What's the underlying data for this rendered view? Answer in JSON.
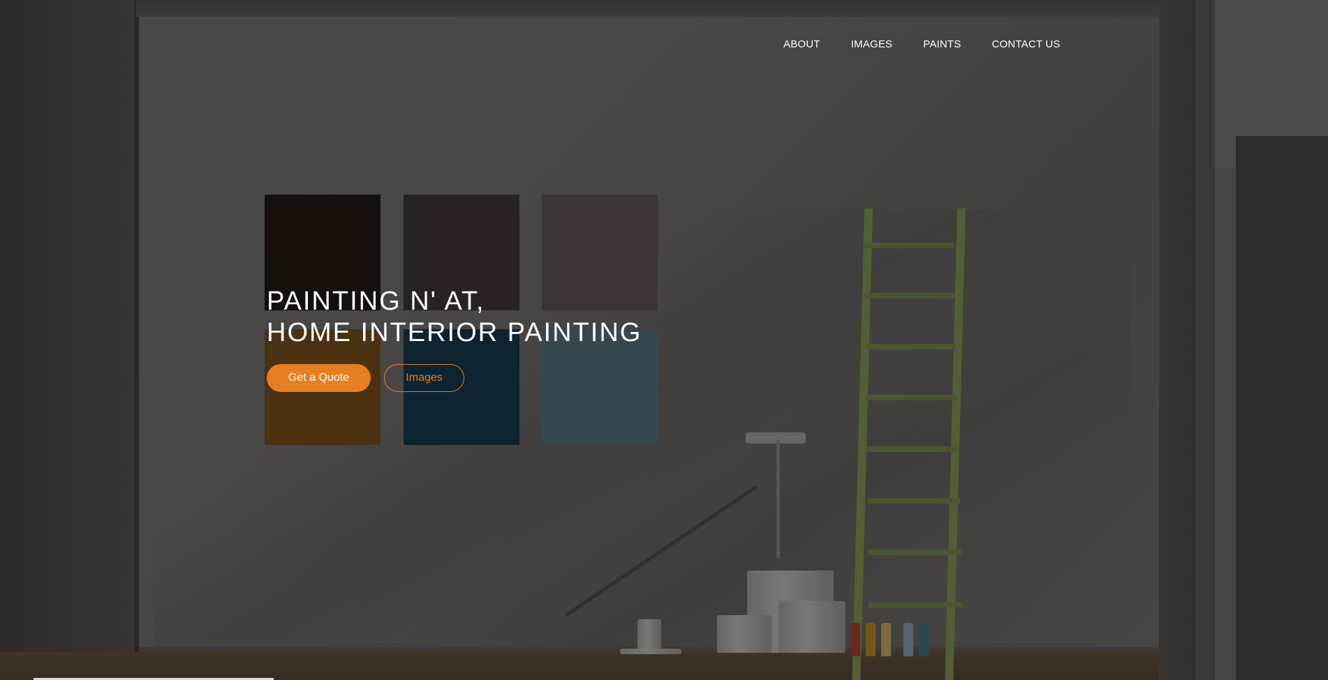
{
  "nav": {
    "items": [
      {
        "label": "ABOUT"
      },
      {
        "label": "IMAGES"
      },
      {
        "label": "PAINTS"
      },
      {
        "label": "CONTACT US"
      }
    ]
  },
  "hero": {
    "title_line1": "PAINTING N' AT,",
    "title_line2": "HOME INTERIOR PAINTING",
    "primary_button": "Get a Quote",
    "secondary_button": "Images"
  },
  "colors": {
    "accent": "#e67e22",
    "text": "#ffffff",
    "swatches": [
      "#16110d",
      "#2a2522",
      "#3d3836",
      "#4e3413",
      "#0f2532",
      "#3a4a54"
    ]
  }
}
